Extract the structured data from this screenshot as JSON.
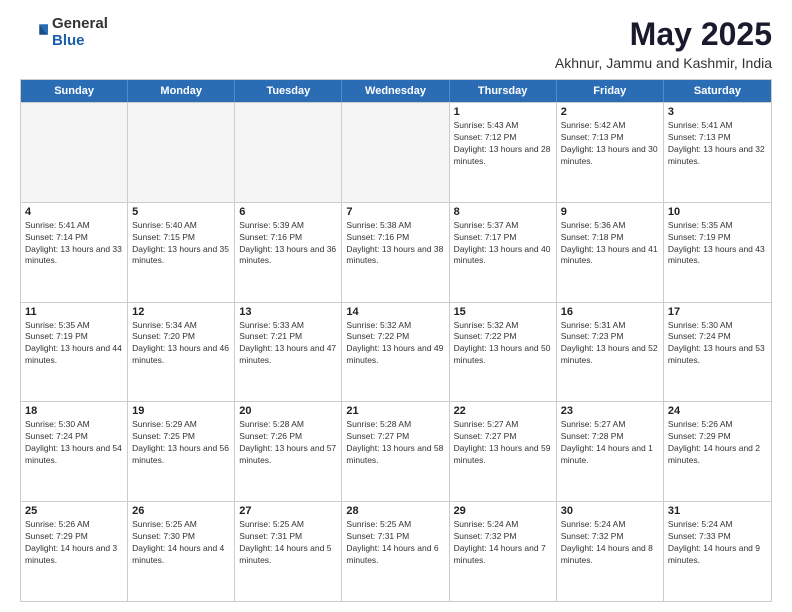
{
  "logo": {
    "general": "General",
    "blue": "Blue"
  },
  "header": {
    "title": "May 2025",
    "subtitle": "Akhnur, Jammu and Kashmir, India"
  },
  "days_of_week": [
    "Sunday",
    "Monday",
    "Tuesday",
    "Wednesday",
    "Thursday",
    "Friday",
    "Saturday"
  ],
  "weeks": [
    [
      {
        "day": "",
        "empty": true
      },
      {
        "day": "",
        "empty": true
      },
      {
        "day": "",
        "empty": true
      },
      {
        "day": "",
        "empty": true
      },
      {
        "day": "1",
        "sunrise": "5:43 AM",
        "sunset": "7:12 PM",
        "daylight": "13 hours and 28 minutes."
      },
      {
        "day": "2",
        "sunrise": "5:42 AM",
        "sunset": "7:13 PM",
        "daylight": "13 hours and 30 minutes."
      },
      {
        "day": "3",
        "sunrise": "5:41 AM",
        "sunset": "7:13 PM",
        "daylight": "13 hours and 32 minutes."
      }
    ],
    [
      {
        "day": "4",
        "sunrise": "5:41 AM",
        "sunset": "7:14 PM",
        "daylight": "13 hours and 33 minutes."
      },
      {
        "day": "5",
        "sunrise": "5:40 AM",
        "sunset": "7:15 PM",
        "daylight": "13 hours and 35 minutes."
      },
      {
        "day": "6",
        "sunrise": "5:39 AM",
        "sunset": "7:16 PM",
        "daylight": "13 hours and 36 minutes."
      },
      {
        "day": "7",
        "sunrise": "5:38 AM",
        "sunset": "7:16 PM",
        "daylight": "13 hours and 38 minutes."
      },
      {
        "day": "8",
        "sunrise": "5:37 AM",
        "sunset": "7:17 PM",
        "daylight": "13 hours and 40 minutes."
      },
      {
        "day": "9",
        "sunrise": "5:36 AM",
        "sunset": "7:18 PM",
        "daylight": "13 hours and 41 minutes."
      },
      {
        "day": "10",
        "sunrise": "5:35 AM",
        "sunset": "7:19 PM",
        "daylight": "13 hours and 43 minutes."
      }
    ],
    [
      {
        "day": "11",
        "sunrise": "5:35 AM",
        "sunset": "7:19 PM",
        "daylight": "13 hours and 44 minutes."
      },
      {
        "day": "12",
        "sunrise": "5:34 AM",
        "sunset": "7:20 PM",
        "daylight": "13 hours and 46 minutes."
      },
      {
        "day": "13",
        "sunrise": "5:33 AM",
        "sunset": "7:21 PM",
        "daylight": "13 hours and 47 minutes."
      },
      {
        "day": "14",
        "sunrise": "5:32 AM",
        "sunset": "7:22 PM",
        "daylight": "13 hours and 49 minutes."
      },
      {
        "day": "15",
        "sunrise": "5:32 AM",
        "sunset": "7:22 PM",
        "daylight": "13 hours and 50 minutes."
      },
      {
        "day": "16",
        "sunrise": "5:31 AM",
        "sunset": "7:23 PM",
        "daylight": "13 hours and 52 minutes."
      },
      {
        "day": "17",
        "sunrise": "5:30 AM",
        "sunset": "7:24 PM",
        "daylight": "13 hours and 53 minutes."
      }
    ],
    [
      {
        "day": "18",
        "sunrise": "5:30 AM",
        "sunset": "7:24 PM",
        "daylight": "13 hours and 54 minutes."
      },
      {
        "day": "19",
        "sunrise": "5:29 AM",
        "sunset": "7:25 PM",
        "daylight": "13 hours and 56 minutes."
      },
      {
        "day": "20",
        "sunrise": "5:28 AM",
        "sunset": "7:26 PM",
        "daylight": "13 hours and 57 minutes."
      },
      {
        "day": "21",
        "sunrise": "5:28 AM",
        "sunset": "7:27 PM",
        "daylight": "13 hours and 58 minutes."
      },
      {
        "day": "22",
        "sunrise": "5:27 AM",
        "sunset": "7:27 PM",
        "daylight": "13 hours and 59 minutes."
      },
      {
        "day": "23",
        "sunrise": "5:27 AM",
        "sunset": "7:28 PM",
        "daylight": "14 hours and 1 minute."
      },
      {
        "day": "24",
        "sunrise": "5:26 AM",
        "sunset": "7:29 PM",
        "daylight": "14 hours and 2 minutes."
      }
    ],
    [
      {
        "day": "25",
        "sunrise": "5:26 AM",
        "sunset": "7:29 PM",
        "daylight": "14 hours and 3 minutes."
      },
      {
        "day": "26",
        "sunrise": "5:25 AM",
        "sunset": "7:30 PM",
        "daylight": "14 hours and 4 minutes."
      },
      {
        "day": "27",
        "sunrise": "5:25 AM",
        "sunset": "7:31 PM",
        "daylight": "14 hours and 5 minutes."
      },
      {
        "day": "28",
        "sunrise": "5:25 AM",
        "sunset": "7:31 PM",
        "daylight": "14 hours and 6 minutes."
      },
      {
        "day": "29",
        "sunrise": "5:24 AM",
        "sunset": "7:32 PM",
        "daylight": "14 hours and 7 minutes."
      },
      {
        "day": "30",
        "sunrise": "5:24 AM",
        "sunset": "7:32 PM",
        "daylight": "14 hours and 8 minutes."
      },
      {
        "day": "31",
        "sunrise": "5:24 AM",
        "sunset": "7:33 PM",
        "daylight": "14 hours and 9 minutes."
      }
    ]
  ]
}
